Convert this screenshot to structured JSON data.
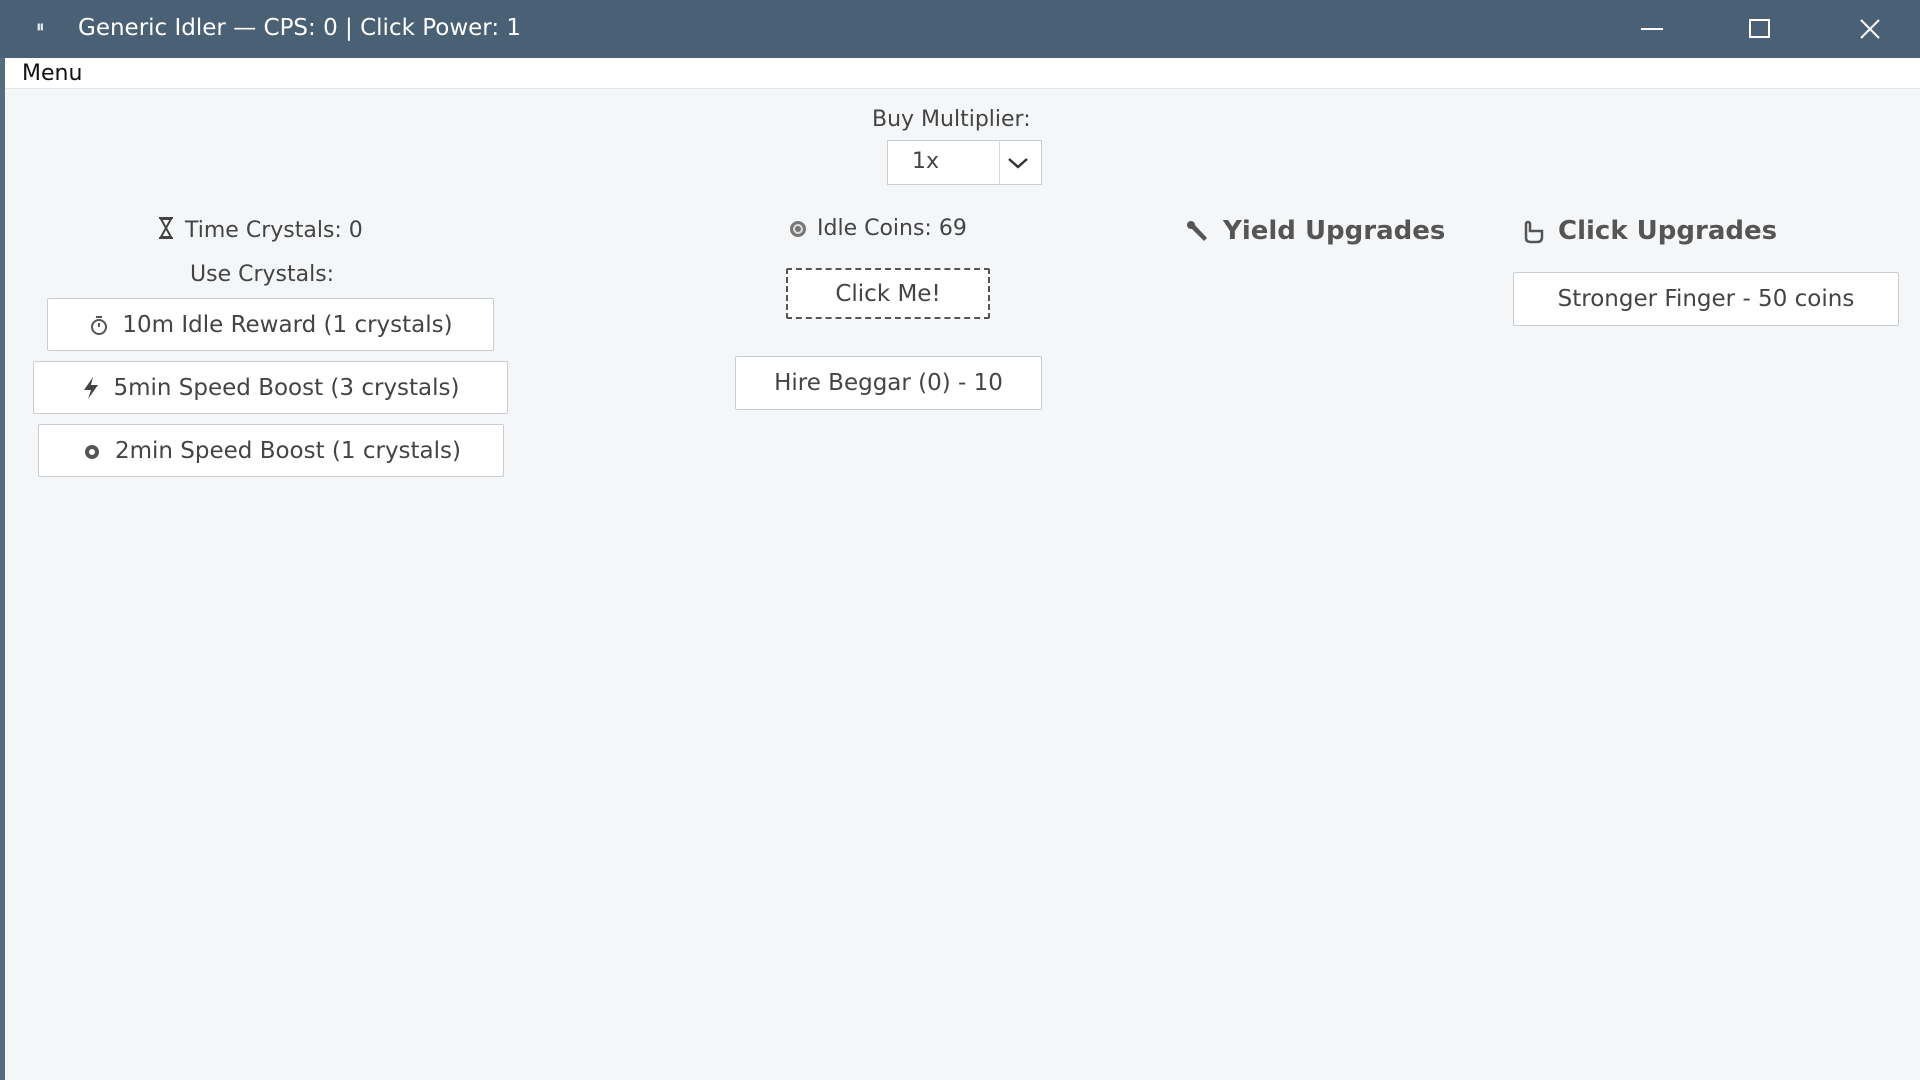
{
  "window": {
    "title": "Generic Idler — CPS: 0 | Click Power: 1",
    "app_icon": "⏸"
  },
  "menubar": {
    "menu_label": "Menu"
  },
  "multiplier": {
    "label": "Buy Multiplier:",
    "selected": "1x"
  },
  "crystals": {
    "label": "Time Crystals: 0",
    "use_label": "Use Crystals:",
    "buttons": [
      {
        "label": "10m Idle Reward (1 crystals)",
        "icon": "stopwatch-icon"
      },
      {
        "label": "5min Speed Boost (3 crystals)",
        "icon": "lightning-icon"
      },
      {
        "label": "2min Speed Boost (1 crystals)",
        "icon": "gem-icon"
      }
    ]
  },
  "coins": {
    "label": "Idle Coins: 69",
    "click_label": "Click Me!",
    "hire_label": "Hire Beggar (0) - 10"
  },
  "yield_upgrades": {
    "title": "Yield Upgrades"
  },
  "click_upgrades": {
    "title": "Click Upgrades",
    "items": [
      {
        "label": "Stronger Finger - 50 coins"
      }
    ]
  },
  "colors": {
    "titlebar": "#4a6074",
    "background": "#f4f6f8",
    "accent": "#4a6074"
  }
}
